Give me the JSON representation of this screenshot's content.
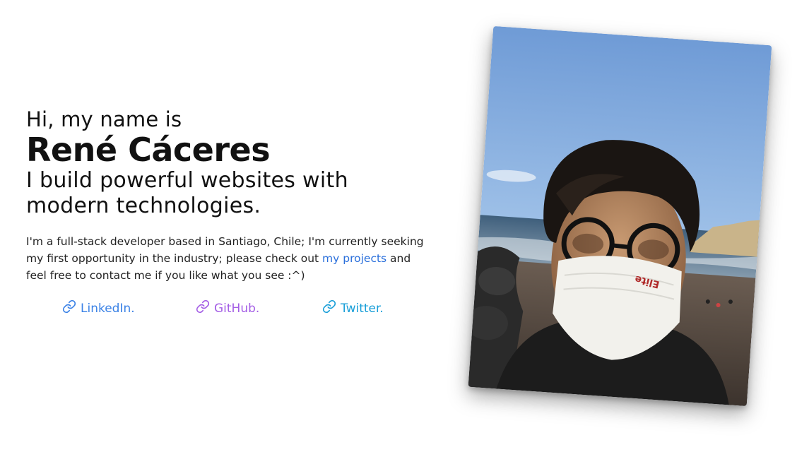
{
  "hero": {
    "greeting": "Hi, my name is",
    "name": "René Cáceres",
    "tagline": "I build powerful websites with modern technologies.",
    "bio_before": "I'm a full-stack developer based in Santiago, Chile; I'm currently seeking my first opportunity in the industry; please check out ",
    "bio_link": "my projects",
    "bio_after": " and feel free to contact me if you like what you see :^)"
  },
  "social_links": [
    {
      "label": "LinkedIn.",
      "icon": "link-icon",
      "color": "#3b82e6"
    },
    {
      "label": "GitHub.",
      "icon": "link-icon",
      "color": "#a45ee5"
    },
    {
      "label": "Twitter.",
      "icon": "link-icon",
      "color": "#1a9fd8"
    }
  ],
  "photo": {
    "elite_text": "Elite"
  }
}
